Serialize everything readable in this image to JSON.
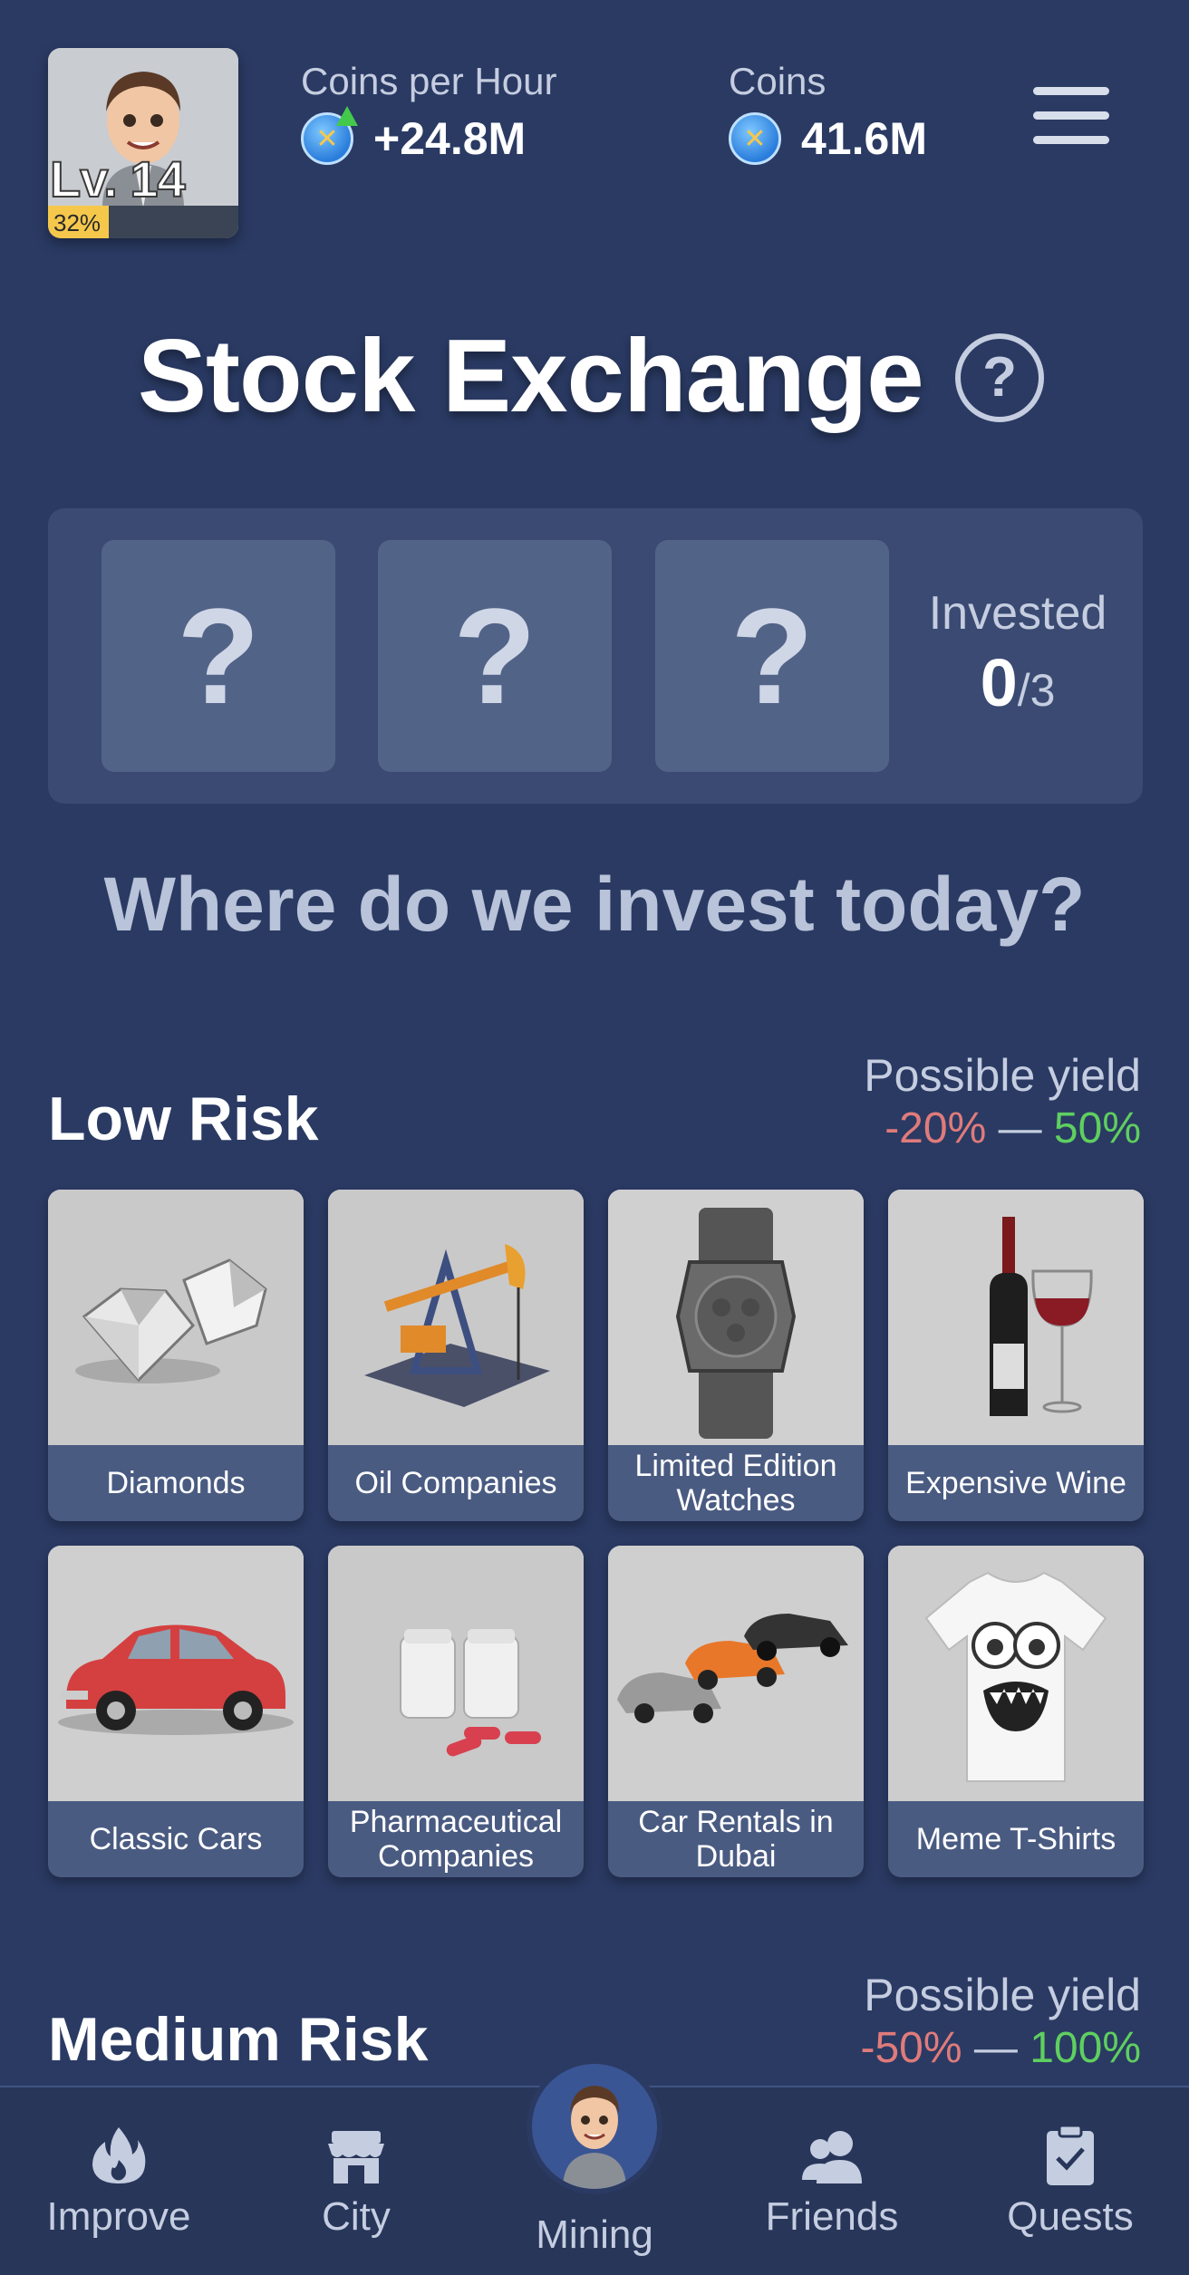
{
  "header": {
    "level_text": "Lv. 14",
    "level_progress_text": "32%",
    "level_progress": 0.32,
    "coins_per_hour_label": "Coins per Hour",
    "coins_per_hour_value": "+24.8M",
    "coins_label": "Coins",
    "coins_value": "41.6M",
    "coin_icon": "coin-icon",
    "menu_icon": "hamburger-menu-icon"
  },
  "title": {
    "text": "Stock Exchange",
    "help_symbol": "?"
  },
  "invested_panel": {
    "slots": [
      "?",
      "?",
      "?"
    ],
    "label": "Invested",
    "count": "0",
    "total": "/3"
  },
  "prompt": "Where do we invest today?",
  "low_risk": {
    "title": "Low Risk",
    "yield_label": "Possible yield",
    "yield_min": "-20%",
    "yield_sep": " — ",
    "yield_max": "50%",
    "items": [
      {
        "label": "Diamonds",
        "icon": "diamonds-image"
      },
      {
        "label": "Oil Companies",
        "icon": "oil-pump-image"
      },
      {
        "label": "Limited Edition Watches",
        "icon": "watch-image"
      },
      {
        "label": "Expensive Wine",
        "icon": "wine-image"
      },
      {
        "label": "Classic Cars",
        "icon": "classic-car-image"
      },
      {
        "label": "Pharmaceutical Companies",
        "icon": "pills-image"
      },
      {
        "label": "Car Rentals in Dubai",
        "icon": "sports-cars-image"
      },
      {
        "label": "Meme T-Shirts",
        "icon": "tshirt-image"
      }
    ]
  },
  "medium_risk": {
    "title": "Medium Risk",
    "yield_label": "Possible yield",
    "yield_min": "-50%",
    "yield_sep": " — ",
    "yield_max": "100%"
  },
  "nav": {
    "items": [
      {
        "label": "Improve",
        "icon": "flame-icon"
      },
      {
        "label": "City",
        "icon": "shop-icon"
      },
      {
        "label": "Mining",
        "icon": "avatar"
      },
      {
        "label": "Friends",
        "icon": "friends-icon"
      },
      {
        "label": "Quests",
        "icon": "clipboard-check-icon"
      }
    ]
  },
  "colors": {
    "background": "#2a3a63",
    "panel": "#3a4a72",
    "negative": "#e07b7b",
    "positive": "#5fcf5f",
    "level_bar": "#f5c84c"
  }
}
